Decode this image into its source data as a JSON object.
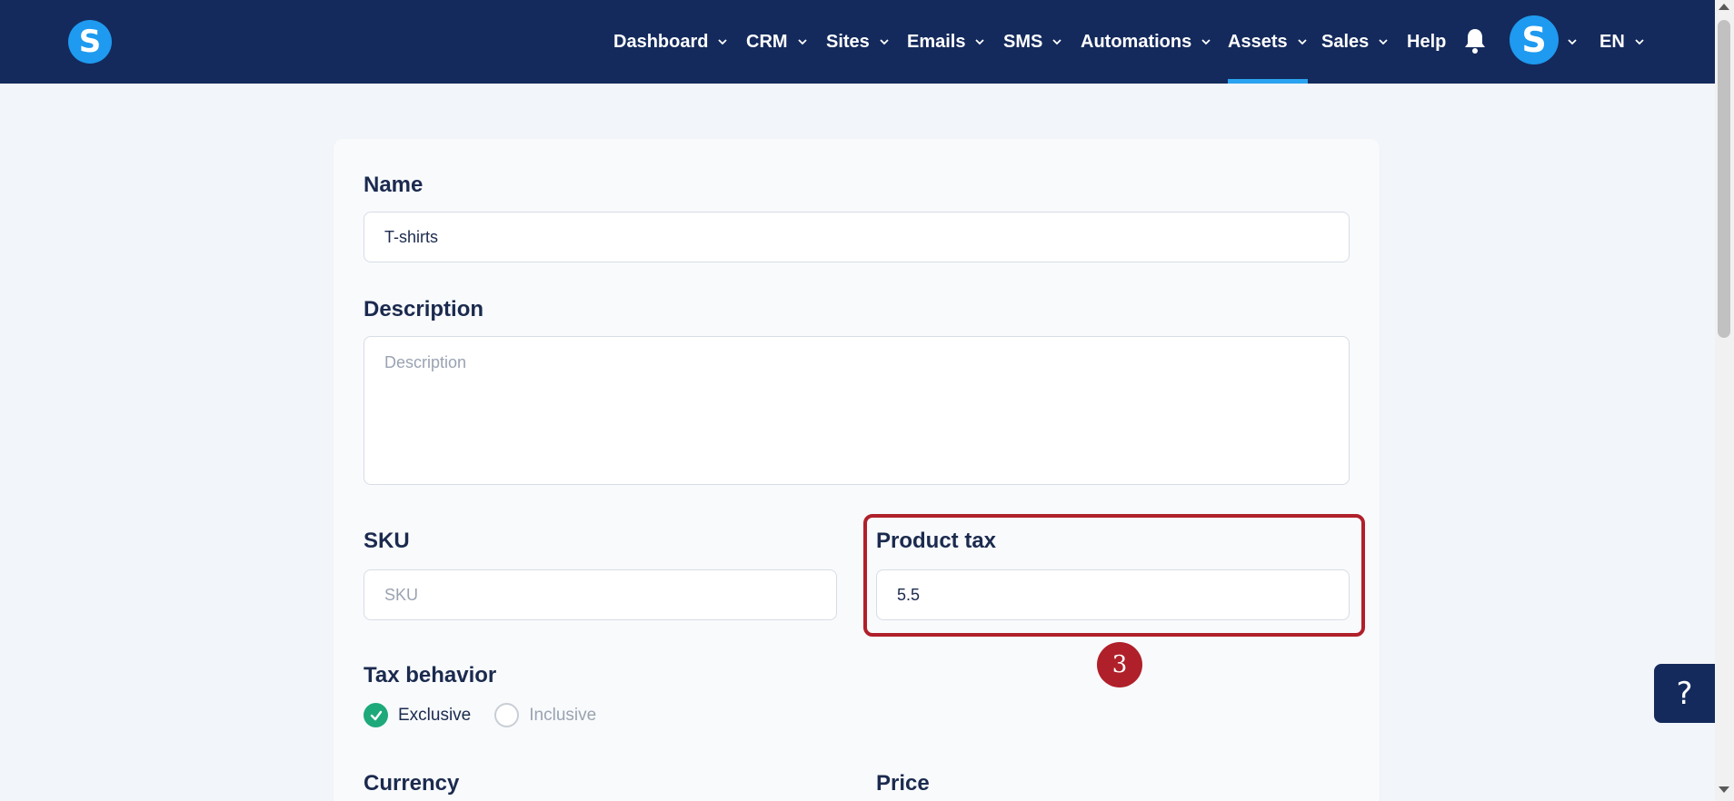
{
  "app": {
    "logo_letter": "S",
    "avatar_letter": "S"
  },
  "nav": {
    "items": [
      {
        "label": "Dashboard",
        "has_dropdown": true
      },
      {
        "label": "CRM",
        "has_dropdown": true
      },
      {
        "label": "Sites",
        "has_dropdown": true
      },
      {
        "label": "Emails",
        "has_dropdown": true
      },
      {
        "label": "SMS",
        "has_dropdown": true
      },
      {
        "label": "Automations",
        "has_dropdown": true
      },
      {
        "label": "Assets",
        "has_dropdown": true,
        "active": true
      },
      {
        "label": "Sales",
        "has_dropdown": true
      },
      {
        "label": "Help",
        "has_dropdown": false
      }
    ],
    "language": "EN"
  },
  "form": {
    "name": {
      "label": "Name",
      "value": "T-shirts"
    },
    "description": {
      "label": "Description",
      "value": "",
      "placeholder": "Description"
    },
    "sku": {
      "label": "SKU",
      "value": "",
      "placeholder": "SKU"
    },
    "product_tax": {
      "label": "Product tax",
      "value": "5.5"
    },
    "tax_behavior": {
      "label": "Tax behavior",
      "options": [
        {
          "label": "Exclusive",
          "selected": true
        },
        {
          "label": "Inclusive",
          "selected": false
        }
      ]
    },
    "currency": {
      "label": "Currency"
    },
    "price": {
      "label": "Price"
    }
  },
  "annotation": {
    "step_number": "3"
  },
  "help_button": {
    "label": "?"
  },
  "colors": {
    "nav_bg": "#142a5c",
    "accent": "#1e9af0",
    "highlight": "#b0202a",
    "success": "#1ea97a"
  }
}
